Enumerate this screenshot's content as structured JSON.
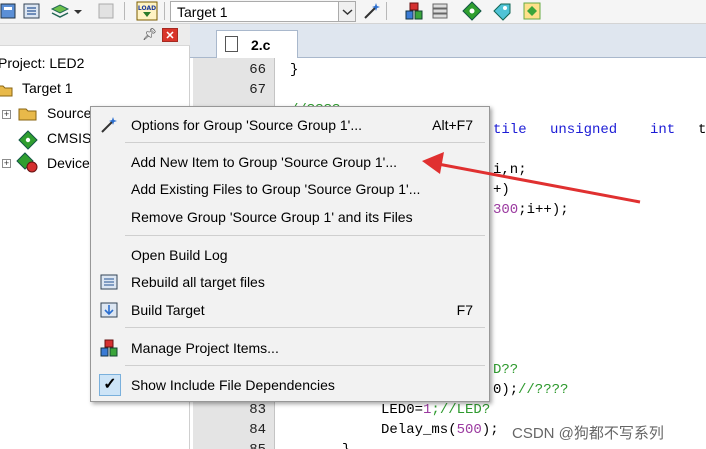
{
  "toolbar": {
    "target_value": "Target 1",
    "icons": [
      "translate-icon",
      "download-icon",
      "manage-icon",
      "load-icon",
      "magic-wand-icon",
      "components-icon",
      "pack-icon",
      "diamond-icon",
      "options-icon"
    ],
    "load_icon_text": "LOAD"
  },
  "project_panel": {
    "title": "Project: LED2",
    "target": "Target 1",
    "items": [
      "Source",
      "CMSIS",
      "Device"
    ]
  },
  "editor": {
    "tab_label": "2.c",
    "line_numbers": [
      "66",
      "67",
      "83",
      "84",
      "85"
    ],
    "code_fragments": {
      "l66": "}",
      "comment_top": "//????",
      "kw_unsigned": "unsigned",
      "kw_int": "int",
      "kw_volatile": "tile",
      "kw_t": "t",
      "vars": "i,n;",
      "paren": "+)",
      "loop": "300;i++);",
      "comment_q1": "D??",
      "call": "0);",
      "comment_q2": "//????",
      "led_assign": "LED0=",
      "led_val": "1",
      "led_comment": ";//LED?",
      "delay": "Delay_ms(",
      "delay_val": "500",
      "delay_end": ");",
      "close_brace": "}"
    }
  },
  "context_menu": {
    "items": [
      {
        "label": "Options for Group 'Source Group 1'...",
        "shortcut": "Alt+F7",
        "icon": "magic-wand-icon"
      },
      {
        "label": "Add New  Item to Group 'Source Group 1'...",
        "shortcut": "",
        "icon": ""
      },
      {
        "label": "Add Existing Files to Group 'Source Group 1'...",
        "shortcut": "",
        "icon": ""
      },
      {
        "label": "Remove Group 'Source Group 1' and its Files",
        "shortcut": "",
        "icon": ""
      },
      {
        "label": "Open Build Log",
        "shortcut": "",
        "icon": ""
      },
      {
        "label": "Rebuild all target files",
        "shortcut": "",
        "icon": "rebuild-icon"
      },
      {
        "label": "Build Target",
        "shortcut": "F7",
        "icon": "build-icon"
      },
      {
        "label": "Manage Project Items...",
        "shortcut": "",
        "icon": "manage-items-icon"
      },
      {
        "label": "Show Include File Dependencies",
        "shortcut": "",
        "icon": "checkmark-icon"
      }
    ],
    "check_glyph": "✓"
  },
  "annotation": {
    "arrow_color": "#e03030"
  },
  "watermark": "CSDN @狗都不写系列",
  "colors": {
    "keyword": "#1c1cd6",
    "comment": "#2e9a2e",
    "number": "#9b3aa0",
    "tab_bg": "#dfe6ef"
  }
}
